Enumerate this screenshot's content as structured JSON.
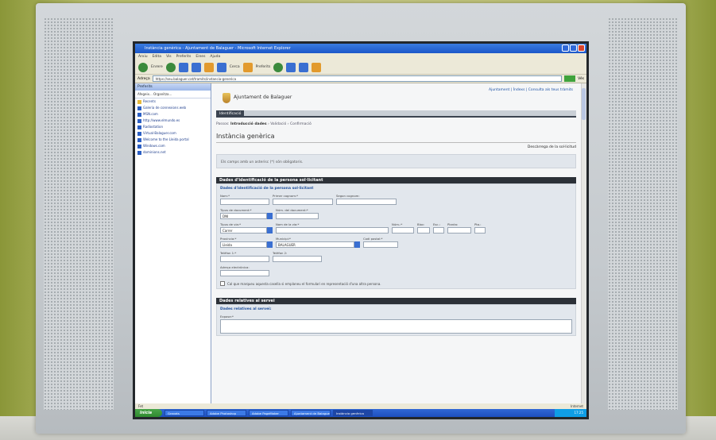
{
  "browser": {
    "title": "Instància genèrica - Ajuntament de Balaguer - Microsoft Internet Explorer",
    "menu": [
      "Arxiu",
      "Edita",
      "Vis",
      "Preferits",
      "Eines",
      "Ajuda"
    ],
    "toolbar": {
      "back": "Enrere",
      "search": "Cerca",
      "favorites": "Preferits"
    },
    "address_label": "Adreça",
    "address": "https://seu.balaguer.cat/tramits/instancia-generica",
    "go": "Vés",
    "favorites_panel": {
      "title": "Preferits",
      "tools": "Afegeix... Organitza...",
      "items": [
        {
          "label": "Recents",
          "folder": true
        },
        {
          "label": "Galeria de connexions web",
          "folder": false
        },
        {
          "label": "MSN.com",
          "folder": false
        },
        {
          "label": "http://www.elmundo.es",
          "folder": false
        },
        {
          "label": "Radiostation",
          "folder": false
        },
        {
          "label": "Virtual-Balaguer.com",
          "folder": false
        },
        {
          "label": "Welcome to the Lleida portal",
          "folder": false
        },
        {
          "label": "Windows.com",
          "folder": false
        },
        {
          "label": "dominions.net",
          "folder": false
        }
      ]
    },
    "status_left": "Fet",
    "status_right": "Internet",
    "taskbar": {
      "start": "Inicia",
      "tasks": [
        "Gravats",
        "Adobe Photoshop",
        "Adobe PageMaker",
        "Ajuntament de Balaguer",
        "Instància genèrica"
      ],
      "clock": "17:25"
    }
  },
  "site": {
    "name": "Ajuntament de Balaguer",
    "top_links": "Ajuntament | Índexs | Consulta als teus tràmits",
    "tab": "Identificació",
    "steps": {
      "label": "Passos:",
      "current": "Introducció dades",
      "rest": "› Validació › Confirmació"
    },
    "page_title": "Instància genèrica",
    "help_link": "Descàrrega de la sol·licitud",
    "notice": "Els camps amb un asterisc (*) són obligatoris.",
    "section1": {
      "header": "Dades d'identificació de la persona sol·licitant",
      "subtitle": "Dades d'identificació de la persona sol·licitant",
      "fields": {
        "nom": "Nom:*",
        "cognom1": "Primer cognom:*",
        "cognom2": "Segon cognom:",
        "tipus_doc": "Tipus de document:*",
        "tipus_doc_val": "DNI",
        "num_doc": "Núm. del document:*",
        "tipus_via": "Tipus de via:*",
        "tipus_via_val": "Carrer",
        "nom_via": "Nom de la via:*",
        "num": "Núm.:*",
        "bloc": "Bloc:",
        "esc": "Esc.:",
        "planta": "Planta:",
        "pta": "Pta.:",
        "provincia": "Província:*",
        "provincia_val": "Lleida",
        "municipi": "Municipi:*",
        "municipi_val": "BALAGUER",
        "cp": "Codi postal:*",
        "tel1": "Telèfon 1:*",
        "tel2": "Telèfon 2:",
        "email": "Adreça electrònica:"
      },
      "checkbox": "Cal que marqueu aquesta casella si emplaneu el formulari en representació d'una altra persona."
    },
    "section2": {
      "header": "Dades relatives al servei",
      "subtitle": "Dades relatives al servei:",
      "field": "Expose:*"
    }
  }
}
